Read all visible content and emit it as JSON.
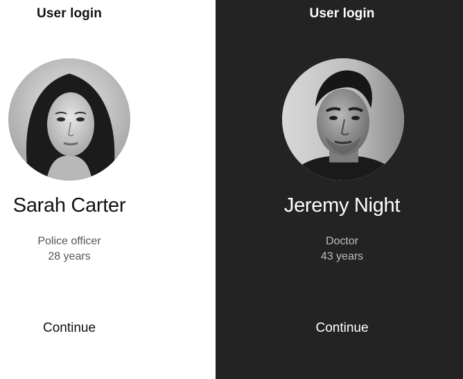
{
  "screens": [
    {
      "theme": "light",
      "background": "#ffffff",
      "header_title": "User login",
      "avatar_icon": "user-photo-sarah",
      "name": "Sarah Carter",
      "occupation": "Police officer",
      "age": "28 years",
      "continue_label": "Continue"
    },
    {
      "theme": "dark",
      "background": "#232323",
      "header_title": "User login",
      "avatar_icon": "user-photo-jeremy",
      "name": "Jeremy Night",
      "occupation": "Doctor",
      "age": "43 years",
      "continue_label": "Continue"
    }
  ]
}
